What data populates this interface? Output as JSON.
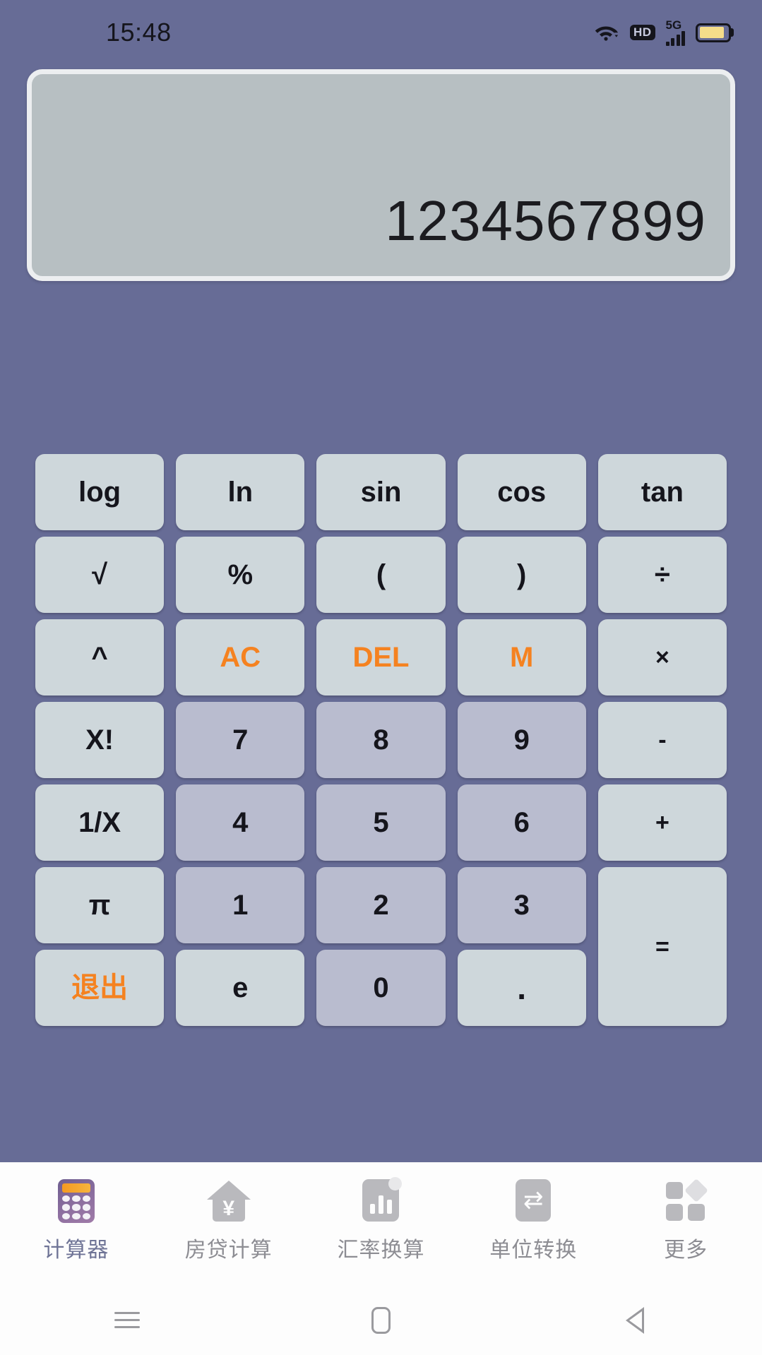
{
  "status_bar": {
    "time": "15:48",
    "hd_label": "HD",
    "network_label": "5G",
    "icons": [
      "wifi-icon",
      "hd-icon",
      "signal-5g-icon",
      "battery-icon"
    ]
  },
  "display": {
    "value": "1234567899"
  },
  "keypad": {
    "rows": [
      [
        {
          "label": "log",
          "type": "func"
        },
        {
          "label": "ln",
          "type": "func"
        },
        {
          "label": "sin",
          "type": "func"
        },
        {
          "label": "cos",
          "type": "func"
        },
        {
          "label": "tan",
          "type": "func"
        }
      ],
      [
        {
          "label": "√",
          "type": "func"
        },
        {
          "label": "%",
          "type": "func"
        },
        {
          "label": "(",
          "type": "func"
        },
        {
          "label": ")",
          "type": "func"
        },
        {
          "label": "÷",
          "type": "func"
        }
      ],
      [
        {
          "label": "^",
          "type": "func"
        },
        {
          "label": "AC",
          "type": "accent"
        },
        {
          "label": "DEL",
          "type": "accent"
        },
        {
          "label": "M",
          "type": "accent"
        },
        {
          "label": "×",
          "type": "func"
        }
      ],
      [
        {
          "label": "X!",
          "type": "func"
        },
        {
          "label": "7",
          "type": "num"
        },
        {
          "label": "8",
          "type": "num"
        },
        {
          "label": "9",
          "type": "num"
        },
        {
          "label": "-",
          "type": "func"
        }
      ],
      [
        {
          "label": "1/X",
          "type": "func"
        },
        {
          "label": "4",
          "type": "num"
        },
        {
          "label": "5",
          "type": "num"
        },
        {
          "label": "6",
          "type": "num"
        },
        {
          "label": "+",
          "type": "func"
        }
      ],
      [
        {
          "label": "π",
          "type": "func"
        },
        {
          "label": "1",
          "type": "num"
        },
        {
          "label": "2",
          "type": "num"
        },
        {
          "label": "3",
          "type": "num"
        },
        {
          "label": "=",
          "type": "equals"
        }
      ],
      [
        {
          "label": "退出",
          "type": "accent"
        },
        {
          "label": "e",
          "type": "func"
        },
        {
          "label": "0",
          "type": "num"
        },
        {
          "label": ".",
          "type": "dot"
        }
      ]
    ]
  },
  "tabbar": {
    "items": [
      {
        "label": "计算器",
        "icon": "calculator-icon",
        "active": true
      },
      {
        "label": "房贷计算",
        "icon": "house-yen-icon",
        "active": false
      },
      {
        "label": "汇率换算",
        "icon": "bar-chart-icon",
        "active": false
      },
      {
        "label": "单位转换",
        "icon": "swap-arrows-icon",
        "active": false
      },
      {
        "label": "更多",
        "icon": "grid-more-icon",
        "active": false
      }
    ]
  },
  "navbar": {
    "recent": "recents-icon",
    "home": "home-icon",
    "back": "back-icon"
  },
  "colors": {
    "background": "#676c96",
    "display_bg": "#b7bfc2",
    "key_func": "#ced7db",
    "key_num": "#b9bccf",
    "accent": "#f58220",
    "tabbar_bg": "#fdfdfd",
    "tab_inactive": "#8d8d93",
    "tab_active": "#6f7496"
  }
}
